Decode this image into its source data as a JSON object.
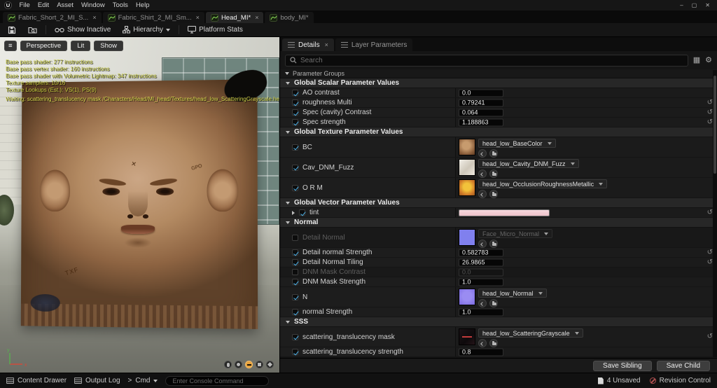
{
  "colors": {
    "accent_blue": "#4db1e8",
    "selected_orange": "#e8a33d",
    "stats_yellow": "#c6c93f",
    "tint_swatch": "#f2ccd2"
  },
  "icons": {
    "logo": "U",
    "burger": "≡",
    "close": "×",
    "minimize": "–",
    "maximize": "▢",
    "close_window": "✕",
    "reset": "↺",
    "gear": "⚙",
    "grid": "▦",
    "cmd_prompt": ">"
  },
  "menu": {
    "items": [
      "File",
      "Edit",
      "Asset",
      "Window",
      "Tools",
      "Help"
    ]
  },
  "tabs": [
    {
      "label": "Fabric_Short_2_MI_S..."
    },
    {
      "label": "Fabric_Shirt_2_MI_Sm..."
    },
    {
      "label": "Head_MI*"
    },
    {
      "label": "body_MI*"
    }
  ],
  "toolbar": {
    "show_inactive": "Show Inactive",
    "hierarchy": "Hierarchy",
    "platform_stats": "Platform Stats"
  },
  "viewport": {
    "buttons": {
      "perspective": "Perspective",
      "lit": "Lit",
      "show": "Show"
    },
    "stats": [
      "Base pass shader: 277 instructions",
      "Base pass vertex shader: 160 instructions",
      "Base pass shader with Volumetric Lightmap: 347 instructions",
      "Texture samplers: 10/16",
      "Texture Lookups (Est.): VS(1), PS(9)"
    ],
    "warning": "Waiting: scattering_translucency mask /Characters/Head/MI_head/Textures/head_low_ScatteringGrayscale.head_low_ScatteringGrayscale",
    "texture_marks": {
      "forehead": "✕",
      "cheek": "GPO",
      "chest": "TXF"
    },
    "axis": {
      "x": "x",
      "y": "y"
    }
  },
  "details": {
    "tabs": {
      "details": "Details",
      "layer_parameters": "Layer Parameters"
    },
    "search_placeholder": "Search",
    "parameter_groups": "Parameter Groups",
    "sections": {
      "scalar": {
        "title": "Global Scalar Parameter Values",
        "rows": [
          {
            "label": "AO contrast",
            "value": "0.0"
          },
          {
            "label": "roughness Multi",
            "value": "0.79241"
          },
          {
            "label": "Spec (cavity) Contrast",
            "value": "0.064"
          },
          {
            "label": "Spec strength",
            "value": "1.188863"
          }
        ]
      },
      "texture": {
        "title": "Global Texture Parameter Values",
        "rows": [
          {
            "label": "BC",
            "asset": "head_low_BaseColor"
          },
          {
            "label": "Cav_DNM_Fuzz",
            "asset": "head_low_Cavity_DNM_Fuzz"
          },
          {
            "label": "O R M",
            "asset": "head_low_OcclusionRoughnessMetallic"
          }
        ]
      },
      "vector": {
        "title": "Global Vector Parameter Values",
        "rows": [
          {
            "label": "tint"
          }
        ]
      },
      "normal": {
        "title": "Normal",
        "rows": [
          {
            "label": "Detail Normal",
            "asset": "Face_Micro_Normal",
            "enabled": false
          },
          {
            "label": "Detail normal Strength",
            "value": "0.582783"
          },
          {
            "label": "Detail Normal Tiling",
            "value": "26.9865"
          },
          {
            "label": "DNM Mask Contrast",
            "value": "0.0",
            "enabled": false
          },
          {
            "label": "DNM Mask Strength",
            "value": "1.0"
          },
          {
            "label": "N",
            "asset": "head_low_Normal"
          },
          {
            "label": "normal Strength",
            "value": "1.0"
          }
        ]
      },
      "sss": {
        "title": "SSS",
        "rows": [
          {
            "label": "scattering_translucency mask",
            "asset": "head_low_ScatteringGrayscale"
          },
          {
            "label": "scattering_translucency strength",
            "value": "0.8"
          }
        ]
      }
    },
    "save_sibling": "Save Sibling",
    "save_child": "Save Child"
  },
  "status_bar": {
    "content_drawer": "Content Drawer",
    "output_log": "Output Log",
    "cmd": "Cmd",
    "console_placeholder": "Enter Console Command",
    "unsaved": "4 Unsaved",
    "revision_control": "Revision Control"
  }
}
